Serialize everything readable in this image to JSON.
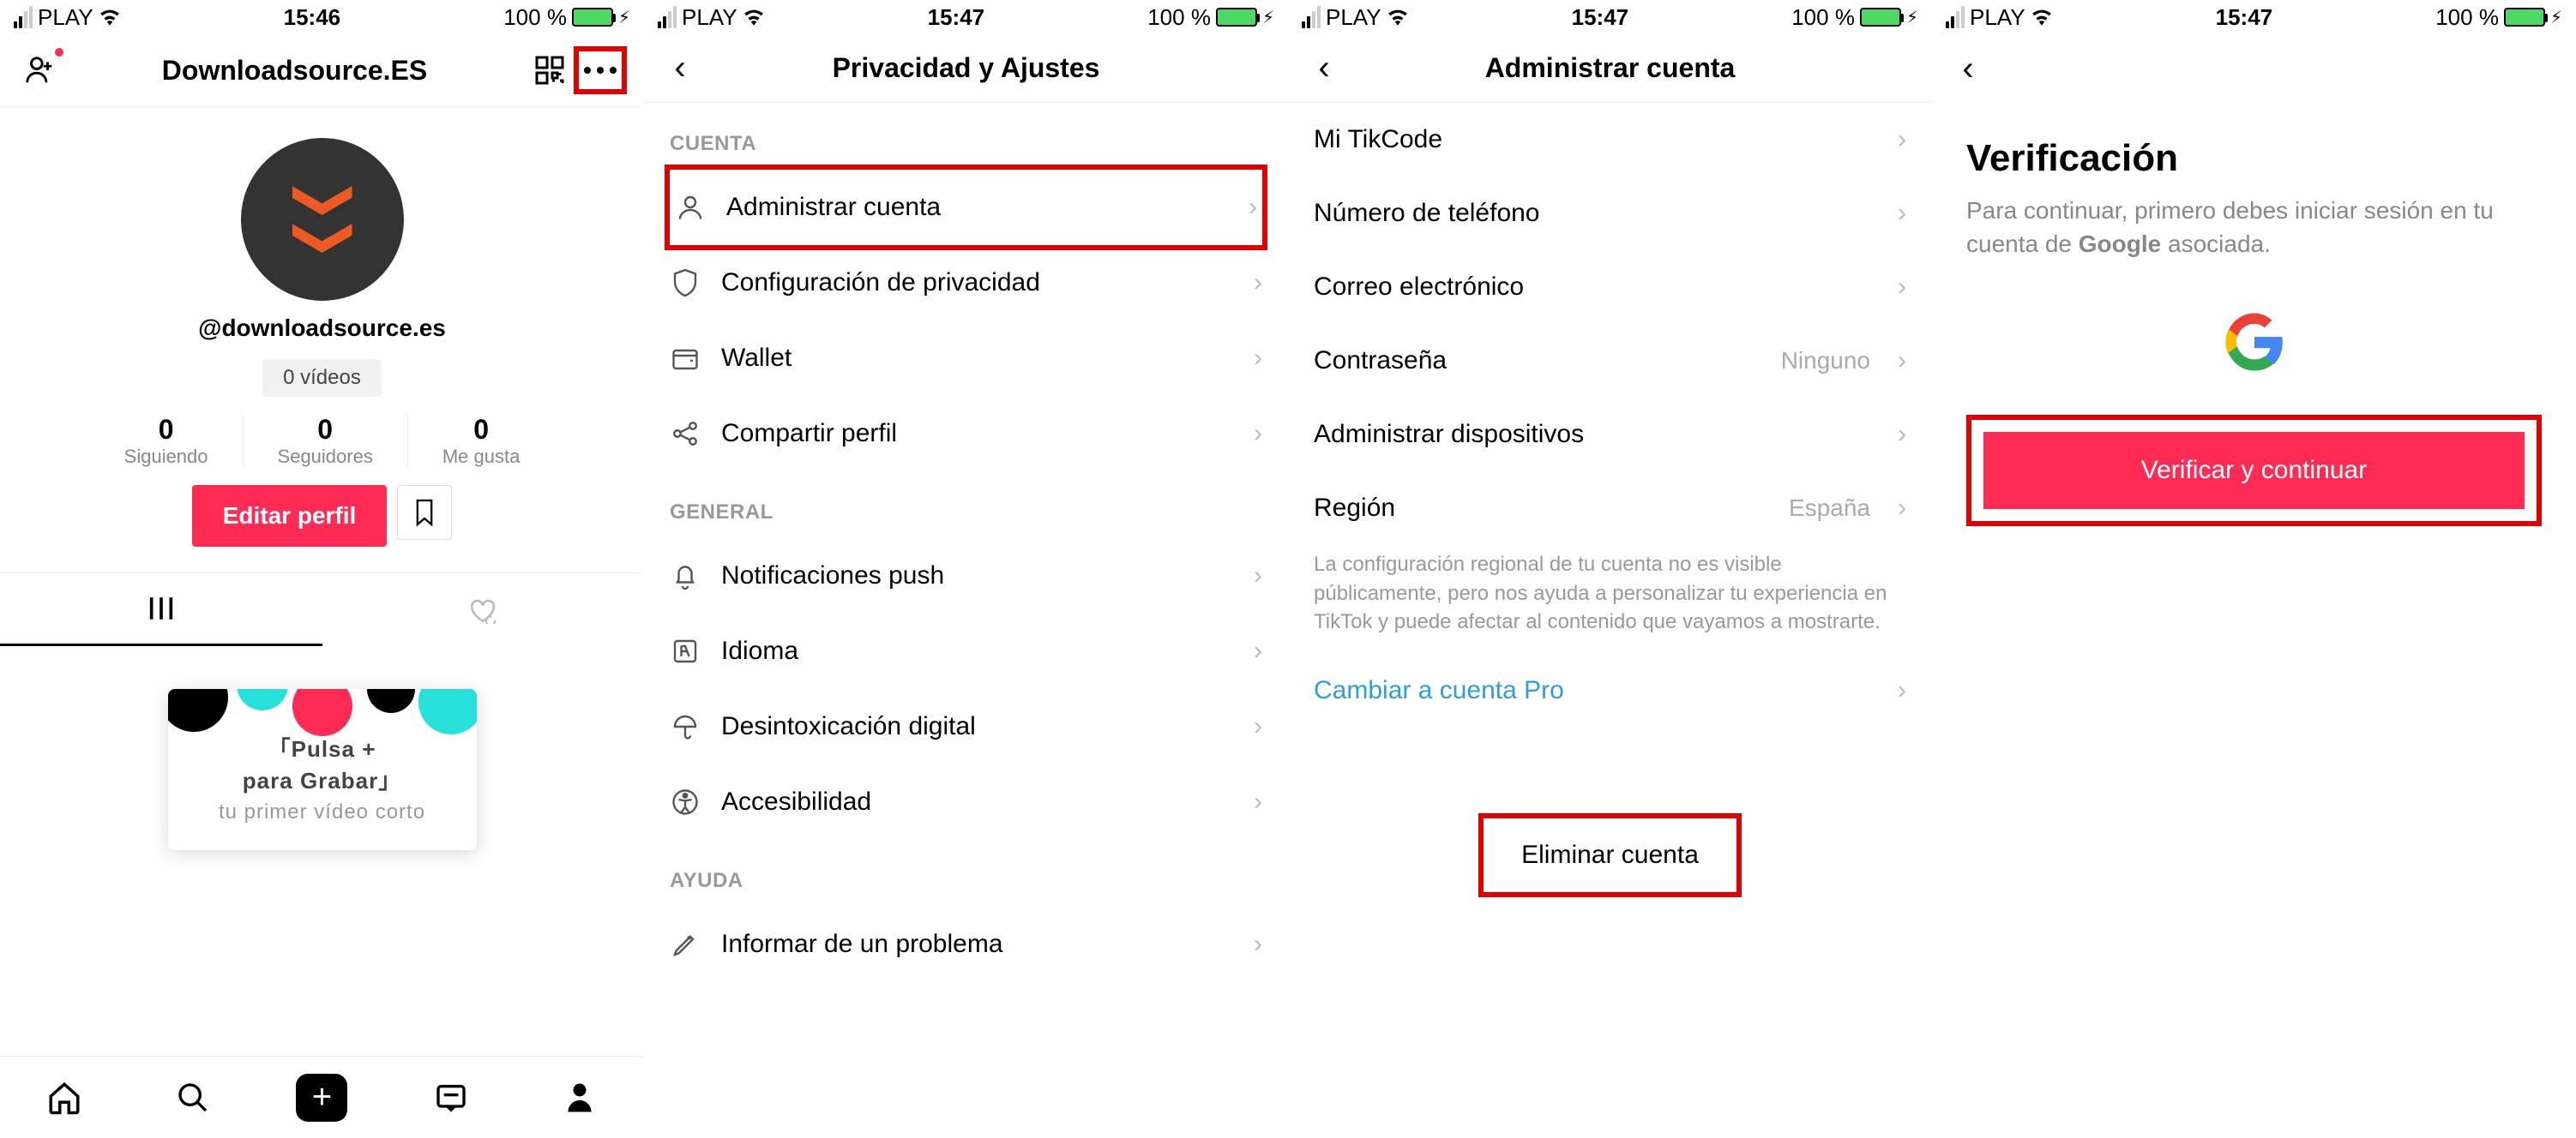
{
  "status": {
    "carrier": "PLAY",
    "battery_text": "100 %"
  },
  "times": [
    "15:46",
    "15:47",
    "15:47",
    "15:47"
  ],
  "panel1": {
    "title": "Downloadsource.ES",
    "username": "@downloadsource.es",
    "videos": "0 vídeos",
    "stats": [
      {
        "num": "0",
        "label": "Siguiendo"
      },
      {
        "num": "0",
        "label": "Seguidores"
      },
      {
        "num": "0",
        "label": "Me gusta"
      }
    ],
    "edit": "Editar perfil",
    "tip1a": "「Pulsa +",
    "tip1b": "para Grabar」",
    "tip2": "tu primer vídeo corto"
  },
  "panel2": {
    "title": "Privacidad y Ajustes",
    "sec_cuenta": "CUENTA",
    "rows_cuenta": [
      "Administrar cuenta",
      "Configuración de privacidad",
      "Wallet",
      "Compartir perfil"
    ],
    "sec_general": "GENERAL",
    "rows_general": [
      "Notificaciones push",
      "Idioma",
      "Desintoxicación digital",
      "Accesibilidad"
    ],
    "sec_ayuda": "AYUDA",
    "rows_ayuda": [
      "Informar de un problema"
    ]
  },
  "panel3": {
    "title": "Administrar cuenta",
    "rows": [
      {
        "label": "Mi TikCode",
        "value": ""
      },
      {
        "label": "Número de teléfono",
        "value": ""
      },
      {
        "label": "Correo electrónico",
        "value": ""
      },
      {
        "label": "Contraseña",
        "value": "Ninguno"
      },
      {
        "label": "Administrar dispositivos",
        "value": ""
      },
      {
        "label": "Región",
        "value": "España"
      }
    ],
    "help": "La configuración regional de tu cuenta no es visible públicamente, pero nos ayuda a personalizar tu experiencia en TikTok y puede afectar al contenido que vayamos a mostrarte.",
    "pro": "Cambiar a cuenta Pro",
    "delete": "Eliminar cuenta"
  },
  "panel4": {
    "title": "Verificación",
    "desc_a": "Para continuar, primero debes iniciar sesión en tu cuenta de ",
    "desc_b": "Google",
    "desc_c": " asociada.",
    "button": "Verificar y continuar"
  }
}
